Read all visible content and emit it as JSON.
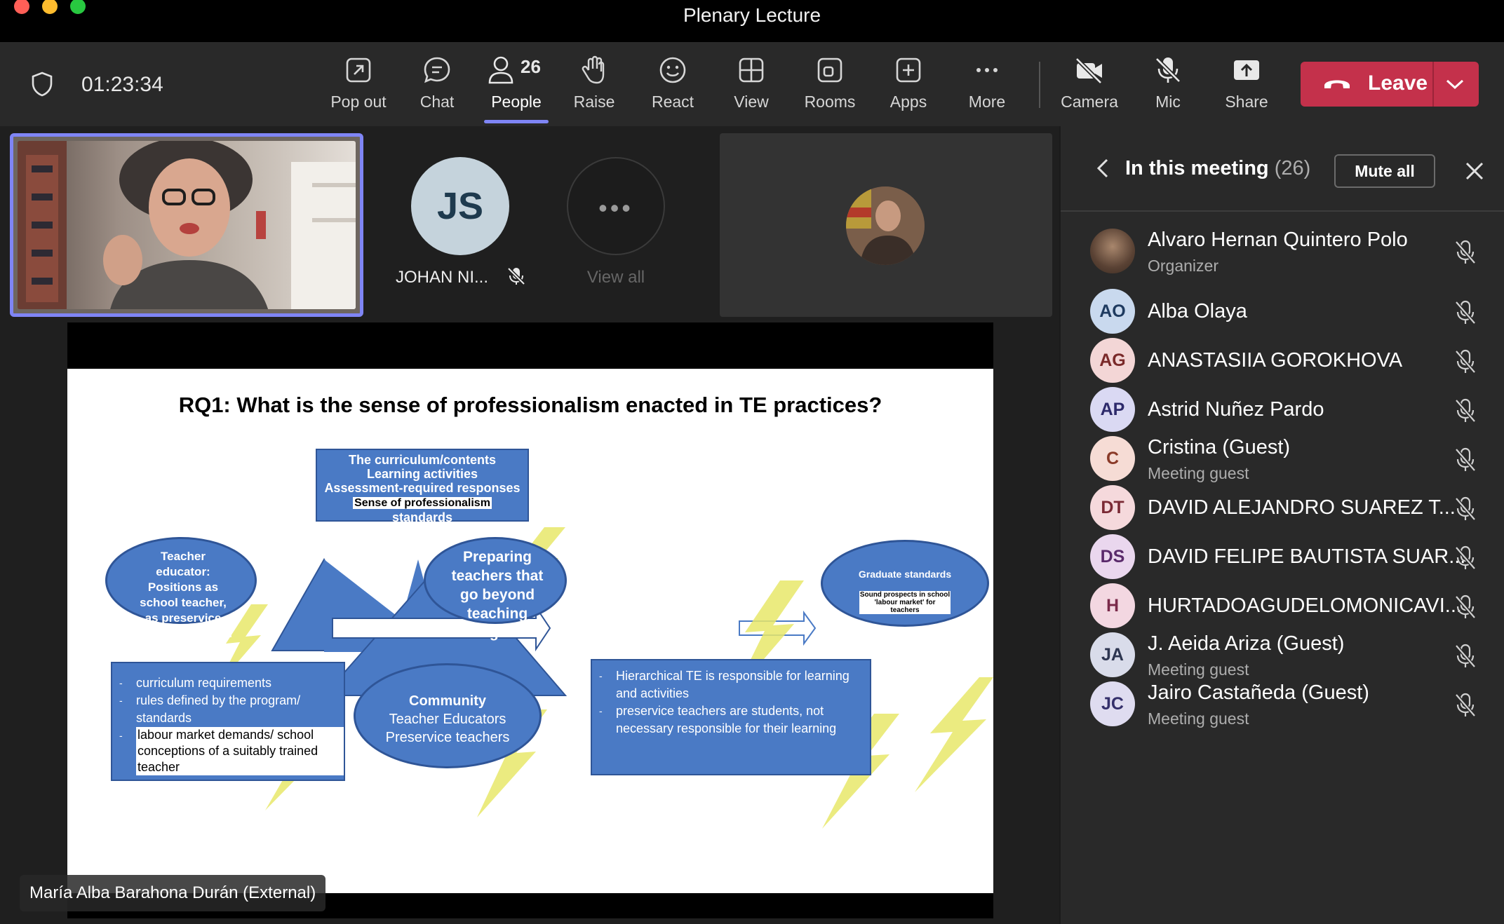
{
  "window": {
    "title": "Plenary Lecture"
  },
  "toolbar": {
    "timer": "01:23:34",
    "buttons": {
      "popout": "Pop out",
      "chat": "Chat",
      "people": "People",
      "people_count": "26",
      "raise": "Raise",
      "react": "React",
      "view": "View",
      "rooms": "Rooms",
      "apps": "Apps",
      "more": "More",
      "camera": "Camera",
      "mic": "Mic",
      "share": "Share",
      "leave": "Leave"
    }
  },
  "gallery": {
    "tile2": {
      "initials": "JS",
      "name": "JOHAN NI..."
    },
    "view_all": "View all"
  },
  "speaker_label": "María Alba Barahona Durán (External)",
  "slide": {
    "title": "RQ1: What is the sense of professionalism enacted in TE practices?",
    "top_box": {
      "lines": [
        "The curriculum/contents",
        "Learning activities",
        "Assessment-required responses"
      ],
      "highlight": "Sense of professionalism",
      "last": "standards"
    },
    "left_oval": "Teacher educator: Positions as school teacher, as preservice teacher, TE, team leader, activist?",
    "mid_oval": "Preparing teachers that go beyond teaching English",
    "right_oval": {
      "title": "Graduate standards",
      "body": "Sound prospects in school 'labour market' for teachers"
    },
    "bottom_left": {
      "items": [
        "curriculum requirements",
        "rules defined by the program/ standards"
      ],
      "highlight": "labour market demands/ school conceptions of a suitably trained teacher"
    },
    "community": {
      "title": "Community",
      "lines": [
        "Teacher Educators",
        "Preservice teachers"
      ]
    },
    "bottom_right": {
      "items": [
        "Hierarchical TE is responsible for learning and activities",
        "preservice teachers are students, not necessary responsible for their learning"
      ]
    }
  },
  "panel": {
    "title": "In this meeting",
    "count": "(26)",
    "mute_all": "Mute all",
    "participants": [
      {
        "initials": "",
        "name": "Alvaro Hernan Quintero Polo",
        "sub": "Organizer"
      },
      {
        "initials": "AO",
        "name": "Alba Olaya",
        "sub": ""
      },
      {
        "initials": "AG",
        "name": "ANASTASIIA GOROKHOVA",
        "sub": ""
      },
      {
        "initials": "AP",
        "name": "Astrid Nuñez Pardo",
        "sub": ""
      },
      {
        "initials": "C",
        "name": "Cristina (Guest)",
        "sub": "Meeting guest"
      },
      {
        "initials": "DT",
        "name": "DAVID ALEJANDRO SUAREZ T...",
        "sub": ""
      },
      {
        "initials": "DS",
        "name": "DAVID FELIPE BAUTISTA SUAR...",
        "sub": ""
      },
      {
        "initials": "H",
        "name": "HURTADOAGUDELOMONICAVI...",
        "sub": ""
      },
      {
        "initials": "JA",
        "name": "J. Aeida Ariza (Guest)",
        "sub": "Meeting guest"
      },
      {
        "initials": "JC",
        "name": "Jairo Castañeda (Guest)",
        "sub": "Meeting guest"
      }
    ]
  },
  "colors": {
    "accent": "#7f85f5",
    "leave": "#c4314b",
    "slide_blue": "#4a7ac5"
  }
}
